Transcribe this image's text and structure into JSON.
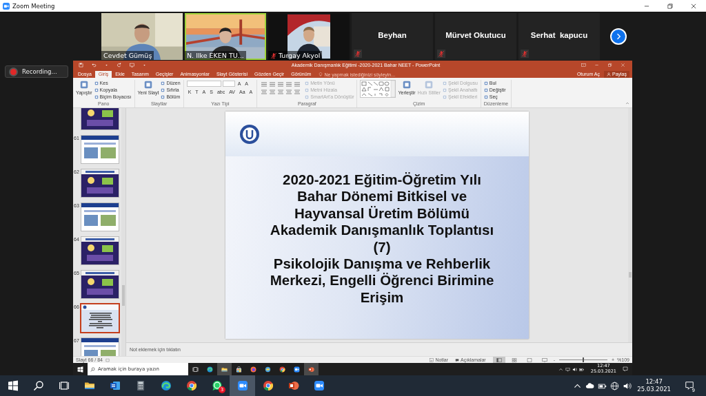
{
  "window": {
    "title": "Zoom Meeting"
  },
  "participants": [
    {
      "name": "Cevdet Gümüş",
      "video": true,
      "muted": false,
      "active_speaker": false
    },
    {
      "name": "N. Ilke EKEN TU...",
      "video": true,
      "muted": false,
      "active_speaker": true
    },
    {
      "name": "Turgay Akyol",
      "video": true,
      "muted": true,
      "active_speaker": false
    },
    {
      "name": "Beyhan",
      "video": false,
      "muted": true,
      "active_speaker": false
    },
    {
      "name": "Mürvet Okutucu",
      "video": false,
      "muted": true,
      "active_speaker": false
    },
    {
      "name": "Serhat  kapucu",
      "video": false,
      "muted": true,
      "active_speaker": false
    }
  ],
  "recording": {
    "label": "Recording..."
  },
  "powerpoint": {
    "title": "Akademik Danışmanlık Eğitimi -2020-2021 Bahar NEET - PowerPoint",
    "tabs": [
      {
        "label": "Dosya",
        "selected": false
      },
      {
        "label": "Giriş",
        "selected": true
      },
      {
        "label": "Ekle",
        "selected": false
      },
      {
        "label": "Tasarım",
        "selected": false
      },
      {
        "label": "Geçişler",
        "selected": false
      },
      {
        "label": "Animasyonlar",
        "selected": false
      },
      {
        "label": "Slayt Gösterisi",
        "selected": false
      },
      {
        "label": "Gözden Geçir",
        "selected": false
      },
      {
        "label": "Görünüm",
        "selected": false
      }
    ],
    "tell_me": "Ne yapmak istediğinizi söyleyin...",
    "sign_in": "Oturum Aç",
    "share": "Paylaş",
    "ribbon": {
      "groups": [
        {
          "name": "Pano",
          "items": [
            {
              "kind": "large",
              "label": "Yapıştır",
              "disabled": false
            },
            {
              "kind": "small",
              "label": "Kes",
              "disabled": false
            },
            {
              "kind": "small",
              "label": "Kopyala",
              "disabled": false
            },
            {
              "kind": "small",
              "label": "Biçim Boyacısı",
              "disabled": false
            }
          ]
        },
        {
          "name": "Slaytlar",
          "items": [
            {
              "kind": "large",
              "label": "Yeni Slayt",
              "disabled": false
            },
            {
              "kind": "small",
              "label": "Düzen",
              "disabled": false
            },
            {
              "kind": "small",
              "label": "Sıfırla",
              "disabled": false
            },
            {
              "kind": "small",
              "label": "Bölüm",
              "disabled": false
            }
          ]
        },
        {
          "name": "Yazı Tipi",
          "items": [
            {
              "kind": "font-controls",
              "disabled": false,
              "top_glyphs": [
                "A",
                "A"
              ],
              "bottom_glyphs": [
                "K",
                "T",
                "A",
                "S",
                "abc",
                "AV",
                "Aa",
                "A"
              ]
            }
          ]
        },
        {
          "name": "Paragraf",
          "items": [
            {
              "kind": "paragraph-controls",
              "disabled": false
            },
            {
              "kind": "small",
              "label": "Metin Yönü",
              "disabled": true
            },
            {
              "kind": "small",
              "label": "Metni Hizala",
              "disabled": true
            },
            {
              "kind": "small",
              "label": "SmartArt'a Dönüştür",
              "disabled": true
            }
          ]
        },
        {
          "name": "Çizim",
          "items": [
            {
              "kind": "shape-gallery",
              "disabled": false
            },
            {
              "kind": "large",
              "label": "Yerleştir",
              "disabled": false
            },
            {
              "kind": "large",
              "label": "Hızlı Stiller",
              "disabled": true
            },
            {
              "kind": "small",
              "label": "Şekil Dolgusu",
              "disabled": true
            },
            {
              "kind": "small",
              "label": "Şekil Anahattı",
              "disabled": true
            },
            {
              "kind": "small",
              "label": "Şekil Efektleri",
              "disabled": true
            }
          ]
        },
        {
          "name": "Düzenleme",
          "items": [
            {
              "kind": "small",
              "label": "Bul",
              "disabled": false
            },
            {
              "kind": "small",
              "label": "Değiştir",
              "disabled": false
            },
            {
              "kind": "small",
              "label": "Seç",
              "disabled": false
            }
          ]
        }
      ]
    },
    "thumbnails": [
      {
        "kind": "dark",
        "selected": false
      },
      {
        "number": "61",
        "kind": "light",
        "selected": false
      },
      {
        "number": "62",
        "kind": "dark",
        "selected": false
      },
      {
        "number": "63",
        "kind": "light",
        "selected": false
      },
      {
        "number": "64",
        "kind": "dark",
        "selected": false
      },
      {
        "number": "65",
        "kind": "dark",
        "selected": false
      },
      {
        "number": "66",
        "kind": "title",
        "selected": true
      },
      {
        "number": "67",
        "kind": "light",
        "selected": false
      }
    ],
    "slide": {
      "title_lines": [
        "2020-2021 Eğitim-Öğretim Yılı",
        "Bahar Dönemi Bitkisel ve",
        "Hayvansal Üretim Bölümü",
        "Akademik Danışmanlık Toplantısı",
        "(7)",
        "Psikolojik Danışma ve Rehberlik",
        "Merkezi, Engelli Öğrenci Birimine",
        "Erişim"
      ]
    },
    "notes_placeholder": "Not eklemek için tıklatın",
    "status_bar": {
      "slide_counter": "Slayt 66 / 84",
      "notes": "Notlar",
      "comments": "Açıklamalar",
      "views": [
        {
          "kind": "normal",
          "selected": true
        },
        {
          "kind": "sorter",
          "selected": false
        },
        {
          "kind": "reading",
          "selected": false
        },
        {
          "kind": "slideshow",
          "selected": false
        }
      ],
      "zoom_out": "-",
      "zoom_slider": {
        "level": 0.5
      },
      "zoom_in": "+",
      "zoom": "%109"
    }
  },
  "shared_taskbar": {
    "search_placeholder": "Aramak için buraya yazın",
    "apps": [
      {
        "kind": "start",
        "active": false
      },
      {
        "kind": "taskview",
        "active": false
      },
      {
        "kind": "edge",
        "active": false
      },
      {
        "kind": "explorer",
        "active": true
      },
      {
        "kind": "store",
        "active": false
      },
      {
        "kind": "firefox",
        "active": false
      },
      {
        "kind": "app",
        "active": false
      },
      {
        "kind": "chrome",
        "active": false
      },
      {
        "kind": "zoom",
        "active": false
      },
      {
        "kind": "powerpoint",
        "active": true
      }
    ],
    "tray": [
      {
        "kind": "chevron"
      },
      {
        "kind": "network"
      },
      {
        "kind": "speaker"
      },
      {
        "kind": "battery"
      }
    ],
    "time": "12:47",
    "date": "25.03.2021"
  },
  "taskbar": {
    "apps": [
      {
        "kind": "start",
        "active": false
      },
      {
        "kind": "search",
        "active": false
      },
      {
        "kind": "taskview",
        "active": false
      },
      {
        "kind": "explorer",
        "active": false
      },
      {
        "kind": "word",
        "active": false
      },
      {
        "kind": "calculator",
        "active": false
      },
      {
        "kind": "edge",
        "active": false
      },
      {
        "kind": "chrome",
        "active": false
      },
      {
        "kind": "whatsapp",
        "active": false,
        "badge": "3"
      },
      {
        "kind": "zoom",
        "active": true
      },
      {
        "kind": "chrome",
        "active": false
      },
      {
        "kind": "powerpoint",
        "active": false
      },
      {
        "kind": "zoom",
        "active": false
      }
    ],
    "tray": [
      {
        "kind": "chevron"
      },
      {
        "kind": "cloud"
      },
      {
        "kind": "battery"
      },
      {
        "kind": "globe"
      },
      {
        "kind": "speaker"
      }
    ],
    "time": "12:47",
    "date": "25.03.2021",
    "notifications": "9"
  }
}
